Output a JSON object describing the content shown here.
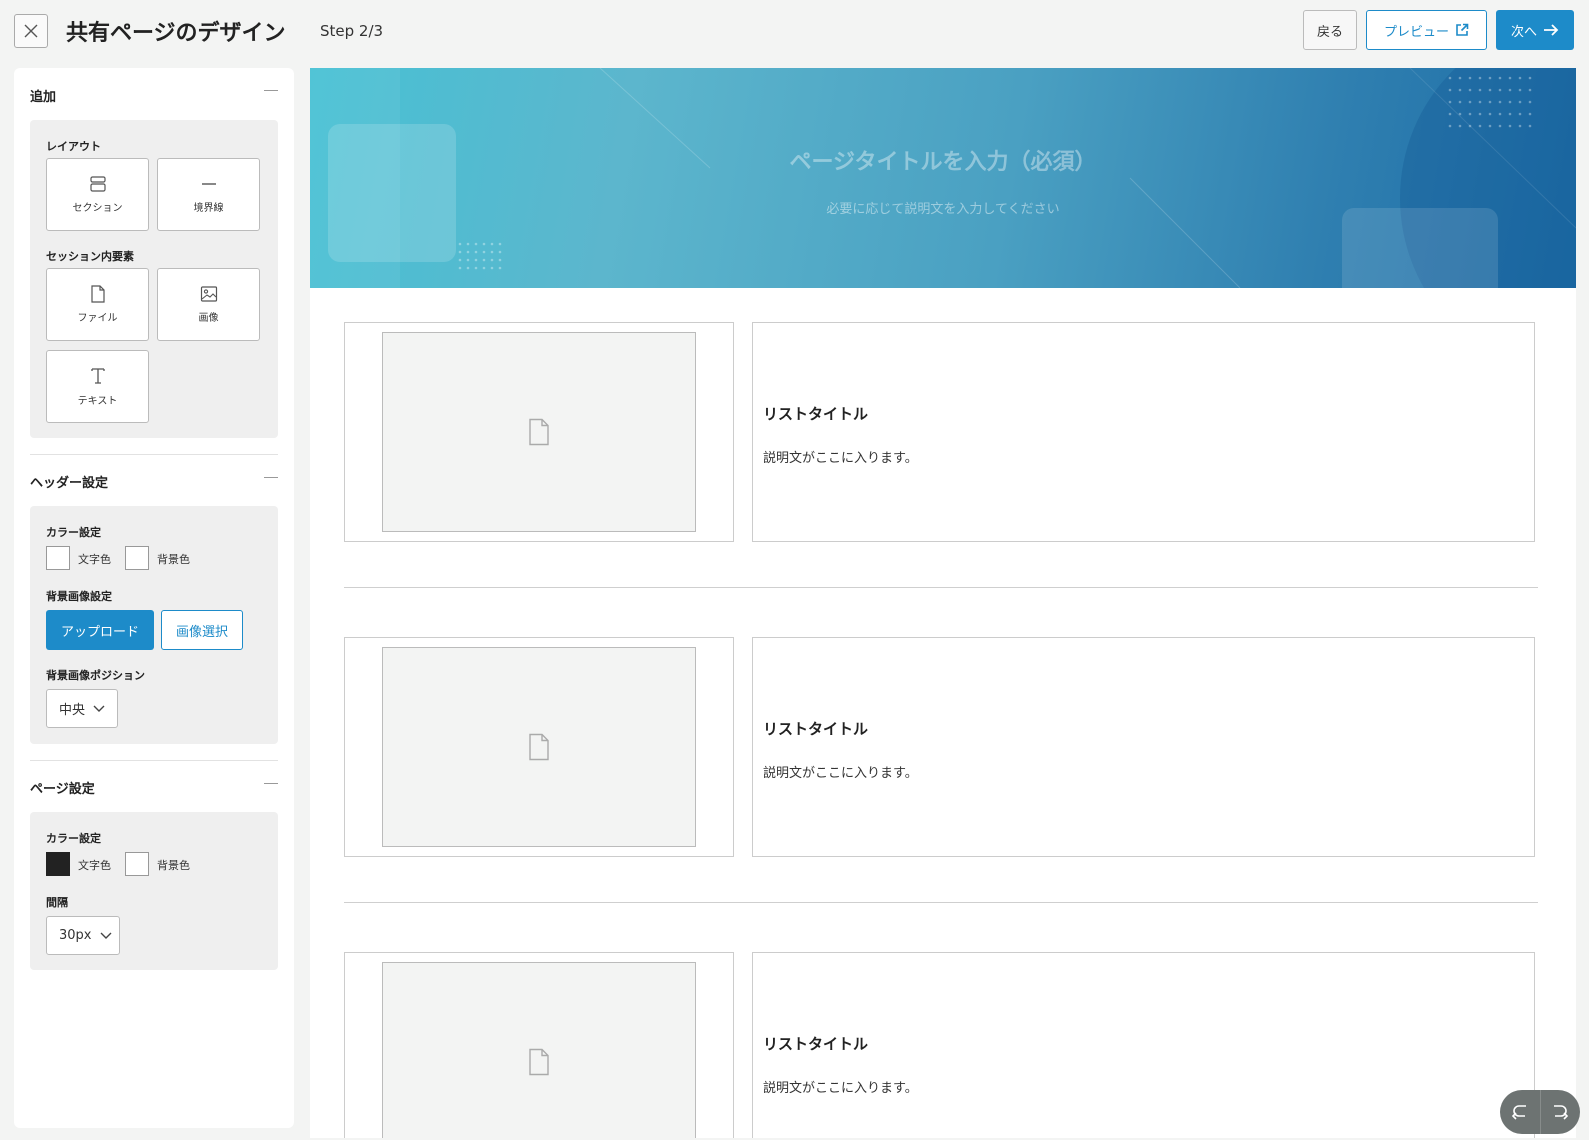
{
  "header": {
    "title": "共有ページのデザイン",
    "step": "Step 2/3",
    "back_label": "戻る",
    "preview_label": "プレビュー",
    "next_label": "次へ"
  },
  "sidebar": {
    "add": {
      "heading": "追加",
      "layout_label": "レイアウト",
      "layout_items": [
        "セクション",
        "境界線"
      ],
      "elements_label": "セッション内要素",
      "element_items": [
        "ファイル",
        "画像",
        "テキスト"
      ]
    },
    "header_settings": {
      "heading": "ヘッダー設定",
      "color_label": "カラー設定",
      "text_color_label": "文字色",
      "bg_color_label": "背景色",
      "text_color": "#ffffff",
      "bg_color": "#ffffff",
      "bg_image_label": "背景画像設定",
      "upload_label": "アップロード",
      "select_image_label": "画像選択",
      "position_label": "背景画像ポジション",
      "position_value": "中央"
    },
    "page_settings": {
      "heading": "ページ設定",
      "color_label": "カラー設定",
      "text_color_label": "文字色",
      "bg_color_label": "背景色",
      "text_color": "#222222",
      "bg_color": "#ffffff",
      "spacing_label": "間隔",
      "spacing_value": "30px"
    }
  },
  "canvas": {
    "hero_title": "ページタイトルを入力（必須）",
    "hero_subtitle": "必要に応じて説明文を入力してください",
    "items": [
      {
        "title": "リストタイトル",
        "description": "説明文がここに入ります。"
      },
      {
        "title": "リストタイトル",
        "description": "説明文がここに入ります。"
      },
      {
        "title": "リストタイトル",
        "description": "説明文がここに入ります。"
      }
    ]
  },
  "colors": {
    "accent": "#1d8bc9",
    "hero_start": "#47c1d4",
    "hero_end": "#1c6ca6"
  }
}
